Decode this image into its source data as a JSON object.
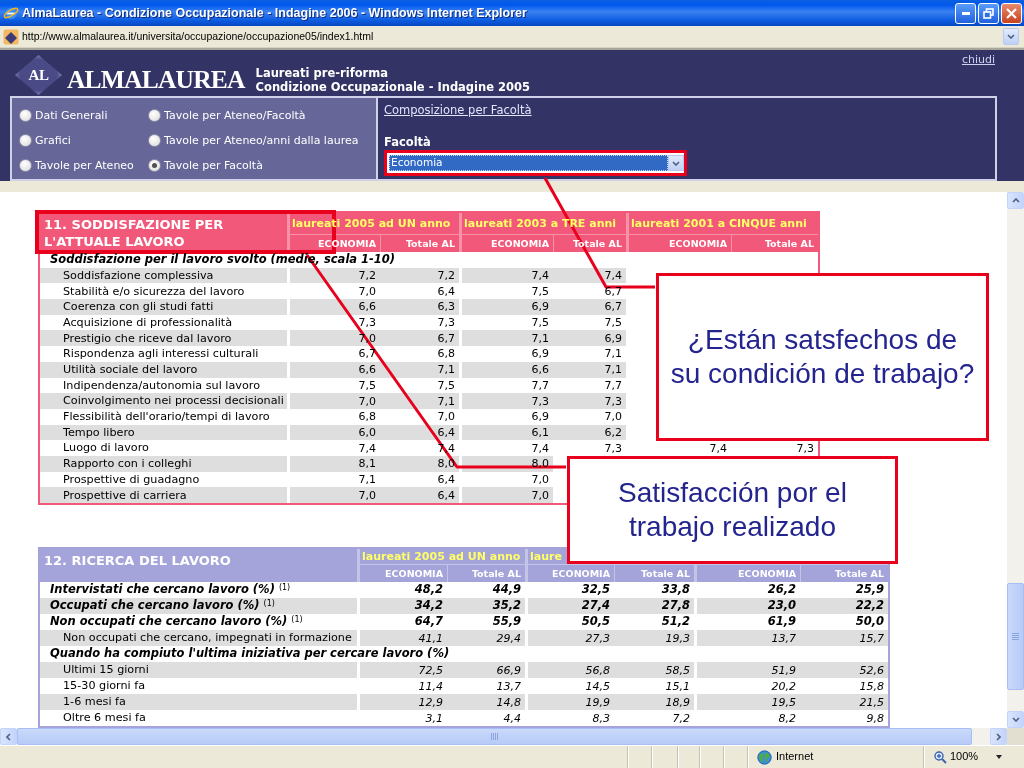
{
  "window": {
    "title": "AlmaLaurea - Condizione Occupazionale - Indagine 2006 - Windows Internet Explorer",
    "address": "http://www.almalaurea.it/universita/occupazione/occupazione05/index1.html"
  },
  "header": {
    "logo_mark": "AL",
    "logo_text": "ALMALAUREA",
    "subtitle": [
      "Laureati pre-riforma",
      "Condizione Occupazionale - Indagine 2005"
    ],
    "close_link": "chiudi"
  },
  "menu": {
    "options": [
      {
        "label": "Dati Generali",
        "selected": false
      },
      {
        "label": "Tavole per Ateneo/Facoltà",
        "selected": false
      },
      {
        "label": "Grafici",
        "selected": false
      },
      {
        "label": "Tavole per Ateneo/anni dalla laurea",
        "selected": false
      },
      {
        "label": "Tavole per Ateneo",
        "selected": false
      },
      {
        "label": "Tavole per Facoltà",
        "selected": true
      }
    ],
    "link": "Composizione per Facoltà",
    "select_label": "Facoltà",
    "select_value": "Economia"
  },
  "tables": [
    {
      "title": "11. SODDISFAZIONE PER L'ATTUALE LAVORO",
      "color": "#f2587a",
      "groups": [
        "laureati 2005 ad UN anno",
        "laureati 2003 a TRE anni",
        "laureati 2001 a CINQUE anni"
      ],
      "columns": [
        "ECONOMIA",
        "Totale AL",
        "ECONOMIA",
        "Totale AL",
        "ECONOMIA",
        "Totale AL"
      ],
      "rows": [
        {
          "kind": "section",
          "label": "Soddisfazione per il lavoro svolto (medie, scala 1-10)"
        },
        {
          "kind": "score",
          "label": "Soddisfazione complessiva",
          "values": [
            "7,2",
            "7,2",
            "7,4",
            "7,4"
          ]
        },
        {
          "kind": "score",
          "label": "Stabilità e/o sicurezza del lavoro",
          "values": [
            "7,0",
            "6,4",
            "7,5",
            "6,7"
          ]
        },
        {
          "kind": "score",
          "label": "Coerenza con gli studi fatti",
          "values": [
            "6,6",
            "6,3",
            "6,9",
            "6,7"
          ]
        },
        {
          "kind": "score",
          "label": "Acquisizione di professionalità",
          "values": [
            "7,3",
            "7,3",
            "7,5",
            "7,5"
          ]
        },
        {
          "kind": "score",
          "label": "Prestigio che riceve dal lavoro",
          "values": [
            "7,0",
            "6,7",
            "7,1",
            "6,9"
          ]
        },
        {
          "kind": "score",
          "label": "Rispondenza agli interessi culturali",
          "values": [
            "6,7",
            "6,8",
            "6,9",
            "7,1"
          ]
        },
        {
          "kind": "score",
          "label": "Utilità sociale del lavoro",
          "values": [
            "6,6",
            "7,1",
            "6,6",
            "7,1"
          ]
        },
        {
          "kind": "score",
          "label": "Indipendenza/autonomia sul lavoro",
          "values": [
            "7,5",
            "7,5",
            "7,7",
            "7,7"
          ]
        },
        {
          "kind": "score",
          "label": "Coinvolgimento nei processi decisionali",
          "values": [
            "7,0",
            "7,1",
            "7,3",
            "7,3"
          ]
        },
        {
          "kind": "score",
          "label": "Flessibilità dell'orario/tempi di lavoro",
          "values": [
            "6,8",
            "7,0",
            "6,9",
            "7,0"
          ]
        },
        {
          "kind": "score",
          "label": "Tempo libero",
          "values": [
            "6,0",
            "6,4",
            "6,1",
            "6,2"
          ]
        },
        {
          "kind": "score",
          "label": "Luogo di lavoro",
          "values": [
            "7,4",
            "7,4",
            "7,4",
            "7,3",
            "7,4",
            "7,3"
          ]
        },
        {
          "kind": "score",
          "label": "Rapporto con i colleghi",
          "values": [
            "8,1",
            "8,0",
            "8,0"
          ]
        },
        {
          "kind": "score",
          "label": "Prospettive di guadagno",
          "values": [
            "7,1",
            "6,4",
            "7,0"
          ]
        },
        {
          "kind": "score",
          "label": "Prospettive di carriera",
          "values": [
            "7,0",
            "6,4",
            "7,0"
          ]
        }
      ]
    },
    {
      "title": "12. RICERCA DEL LAVORO",
      "color": "#a4a4da",
      "groups": [
        "laureati 2005 ad UN anno",
        "laure"
      ],
      "columns": [
        "ECONOMIA",
        "Totale AL",
        "ECONOMIA",
        "Totale AL",
        "ECONOMIA",
        "Totale AL"
      ],
      "rows": [
        {
          "kind": "total",
          "label": "Intervistati che cercano lavoro (%) $^{(1)}$",
          "values": [
            "48,2",
            "44,9",
            "32,5",
            "33,8",
            "26,2",
            "25,9"
          ]
        },
        {
          "kind": "total",
          "label": "Occupati che cercano lavoro (%) $^{(1)}$",
          "values": [
            "34,2",
            "35,2",
            "27,4",
            "27,8",
            "23,0",
            "22,2"
          ]
        },
        {
          "kind": "total",
          "label": "Non occupati che cercano lavoro (%) $^{(1)}$",
          "values": [
            "64,7",
            "55,9",
            "50,5",
            "51,2",
            "61,9",
            "50,0"
          ]
        },
        {
          "kind": "share",
          "label": "Non occupati che cercano, impegnati in formazione",
          "values": [
            "41,1",
            "29,4",
            "27,3",
            "19,3",
            "13,7",
            "15,7"
          ]
        },
        {
          "kind": "section",
          "label": "Quando ha compiuto l'ultima iniziativa per cercare lavoro (%)"
        },
        {
          "kind": "share",
          "label": "Ultimi 15 giorni",
          "values": [
            "72,5",
            "66,9",
            "56,8",
            "58,5",
            "51,9",
            "52,6"
          ]
        },
        {
          "kind": "share",
          "label": "15-30 giorni fa",
          "values": [
            "11,4",
            "13,7",
            "14,5",
            "15,1",
            "20,2",
            "15,8"
          ]
        },
        {
          "kind": "share",
          "label": "1-6 mesi fa",
          "values": [
            "12,9",
            "14,8",
            "19,9",
            "18,9",
            "19,5",
            "21,5"
          ]
        },
        {
          "kind": "share",
          "label": "Oltre 6 mesi fa",
          "values": [
            "3,1",
            "4,4",
            "8,3",
            "7,2",
            "8,2",
            "9,8"
          ]
        }
      ]
    }
  ],
  "callouts": [
    {
      "lines": [
        "¿Están satsfechos de",
        "su condición de trabajo?"
      ]
    },
    {
      "lines": [
        "Satisfacción por el",
        "trabajo realizado"
      ]
    }
  ],
  "status_bar": {
    "zone": "Internet",
    "zoom": "100%"
  }
}
